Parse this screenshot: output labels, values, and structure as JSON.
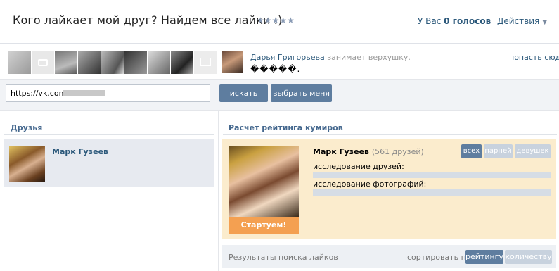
{
  "header": {
    "title": "Кого лайкает мой друг? Найдем все лайки :)",
    "stars": "★★★★★",
    "votes_prefix": "У Вас",
    "votes_count": "0 голосов",
    "actions_label": "Действия"
  },
  "strip": {
    "winner_name": "Дарья Григорьева",
    "winner_text": "занимает верхушку.",
    "winner_status": "�����.",
    "get_there_link": "попасть сюда"
  },
  "search": {
    "url_value": "https://vk.com/",
    "search_button": "искать",
    "pick_me_button": "выбрать меня"
  },
  "friends": {
    "title": "Друзья",
    "items": [
      {
        "name": "Марк Гузеев"
      }
    ]
  },
  "rating": {
    "title": "Расчет рейтинга кумиров",
    "idol_name": "Марк Гузеев",
    "idol_friends": "(561 друзей)",
    "filter_all": "всех",
    "filter_guys": "парней",
    "filter_girls": "девушек",
    "start_button": "Стартуем!",
    "study_friends_label": "исследование друзей:",
    "study_photos_label": "исследование фотографий:",
    "study_friends_progress": 0,
    "study_photos_progress": 0
  },
  "results": {
    "label": "Результаты поиска лайков",
    "sort_label": "сортировать по",
    "sort_rating": "рейтингу",
    "sort_count": "количеству"
  },
  "colors": {
    "accent": "#5e7d9f",
    "link": "#2b587a",
    "idol_bg": "#fbeccd",
    "start_button": "#f4a051"
  }
}
